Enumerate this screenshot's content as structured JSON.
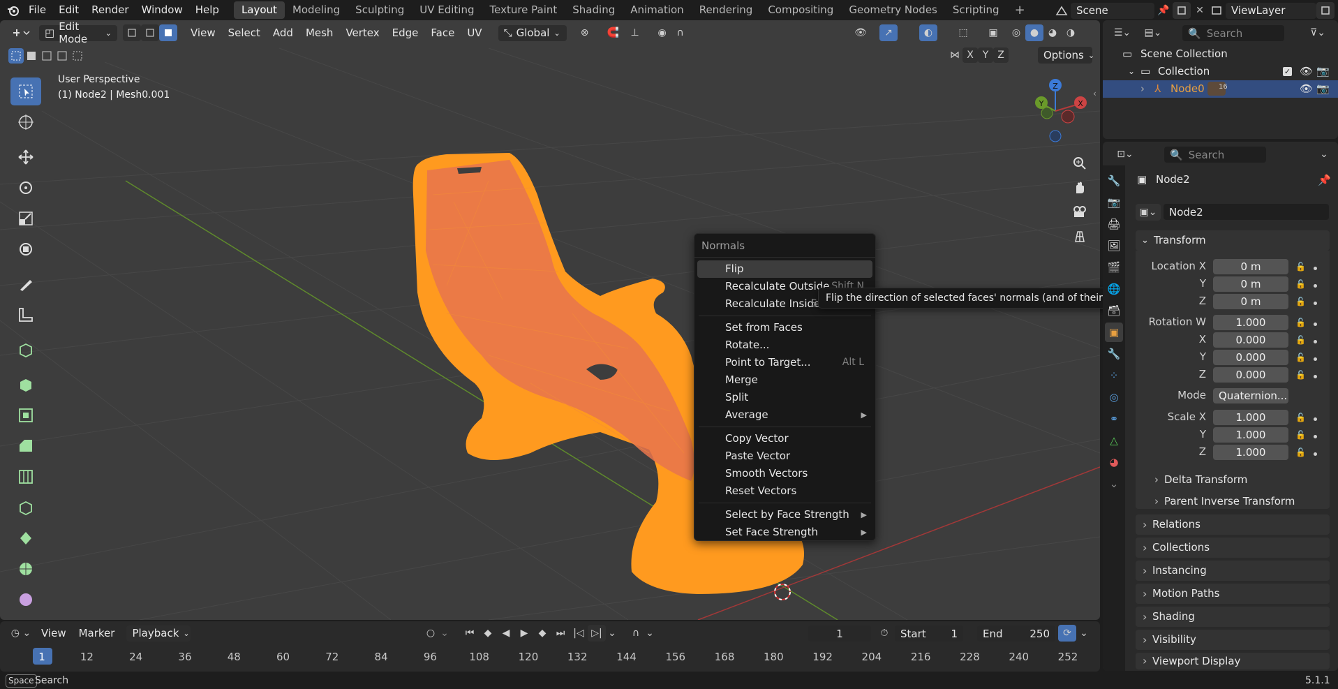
{
  "topbar": {
    "menus": [
      "File",
      "Edit",
      "Render",
      "Window",
      "Help"
    ],
    "workspaces": [
      "Layout",
      "Modeling",
      "Sculpting",
      "UV Editing",
      "Texture Paint",
      "Shading",
      "Animation",
      "Rendering",
      "Compositing",
      "Geometry Nodes",
      "Scripting"
    ],
    "active_workspace": "Layout",
    "add_workspace": "+",
    "scene": "Scene",
    "view_layer": "ViewLayer"
  },
  "viewport_header": {
    "mode": "Edit Mode",
    "menus": [
      "View",
      "Select",
      "Add",
      "Mesh",
      "Vertex",
      "Edge",
      "Face",
      "UV"
    ],
    "transform_orientation": "Global",
    "axes": [
      "X",
      "Y",
      "Z"
    ],
    "options_label": "Options"
  },
  "viewport": {
    "perspective": "User Perspective",
    "object_info": "(1) Node2 | Mesh0.001",
    "gizmo_axes": {
      "z": "Z",
      "y": "Y",
      "x": "X"
    },
    "colors": {
      "background": "#3d3d3d",
      "mesh": "#ff9a1f",
      "mesh_face": "#e8744e",
      "x_axis": "#b33a3a",
      "y_axis": "#6a9a2a"
    }
  },
  "tools": [
    "select-box",
    "cursor",
    "move",
    "rotate",
    "scale",
    "transform",
    "annotate",
    "measure",
    "add-cube",
    "extrude-region",
    "inset-faces",
    "bevel",
    "loop-cut",
    "knife",
    "poly-build",
    "spin",
    "smooth",
    "shrink-fatten"
  ],
  "context_menu": {
    "title": "Normals",
    "items": [
      {
        "label": "Flip",
        "shortcut": "",
        "submenu": false
      },
      {
        "label": "Recalculate Outside",
        "shortcut": "Shift N",
        "submenu": false
      },
      {
        "label": "Recalculate Inside",
        "shortcut": "Shift Ctrl N",
        "submenu": false
      },
      {
        "label": "Set from Faces",
        "shortcut": "",
        "submenu": false
      },
      {
        "label": "Rotate...",
        "shortcut": "",
        "submenu": false
      },
      {
        "label": "Point to Target...",
        "shortcut": "Alt L",
        "submenu": false
      },
      {
        "label": "Merge",
        "shortcut": "",
        "submenu": false
      },
      {
        "label": "Split",
        "shortcut": "",
        "submenu": false
      },
      {
        "label": "Average",
        "shortcut": "",
        "submenu": true
      },
      {
        "label": "Copy Vector",
        "shortcut": "",
        "submenu": false
      },
      {
        "label": "Paste Vector",
        "shortcut": "",
        "submenu": false
      },
      {
        "label": "Smooth Vectors",
        "shortcut": "",
        "submenu": false
      },
      {
        "label": "Reset Vectors",
        "shortcut": "",
        "submenu": false
      },
      {
        "label": "Select by Face Strength",
        "shortcut": "",
        "submenu": true
      },
      {
        "label": "Set Face Strength",
        "shortcut": "",
        "submenu": true
      }
    ]
  },
  "tooltip": "Flip the direction of selected faces' normals (and of their vertices).",
  "timeline": {
    "menus": [
      "View",
      "Marker",
      "Playback"
    ],
    "current_frame": "1",
    "start_label": "Start",
    "start": "1",
    "end_label": "End",
    "end": "250",
    "frame_ticks": [
      "1",
      "12",
      "24",
      "36",
      "48",
      "60",
      "72",
      "84",
      "96",
      "108",
      "120",
      "132",
      "144",
      "156",
      "168",
      "180",
      "192",
      "204",
      "216",
      "228",
      "240",
      "252"
    ]
  },
  "statusbar": {
    "key": "Space",
    "action": "Search",
    "version": "5.1.1"
  },
  "outliner": {
    "search_placeholder": "Search",
    "scene_collection": "Scene Collection",
    "collection": "Collection",
    "node": "Node0",
    "node_badge": "16"
  },
  "properties": {
    "search_placeholder": "Search",
    "object_name": "Node2",
    "object_field": "Node2",
    "transform_label": "Transform",
    "location": {
      "label": "Location X",
      "x": "0 m",
      "y": "0 m",
      "z": "0 m"
    },
    "rotation": {
      "label": "Rotation W",
      "w": "1.000",
      "x": "0.000",
      "y": "0.000",
      "z": "0.000"
    },
    "mode_label": "Mode",
    "mode_value": "Quaternion...",
    "scale": {
      "label": "Scale X",
      "x": "1.000",
      "y": "1.000",
      "z": "1.000"
    },
    "axis_labels": {
      "y": "Y",
      "z": "Z",
      "x": "X"
    },
    "subpanels": [
      "Delta Transform",
      "Parent Inverse Transform"
    ],
    "panels": [
      "Relations",
      "Collections",
      "Instancing",
      "Motion Paths",
      "Shading",
      "Visibility",
      "Viewport Display"
    ]
  }
}
